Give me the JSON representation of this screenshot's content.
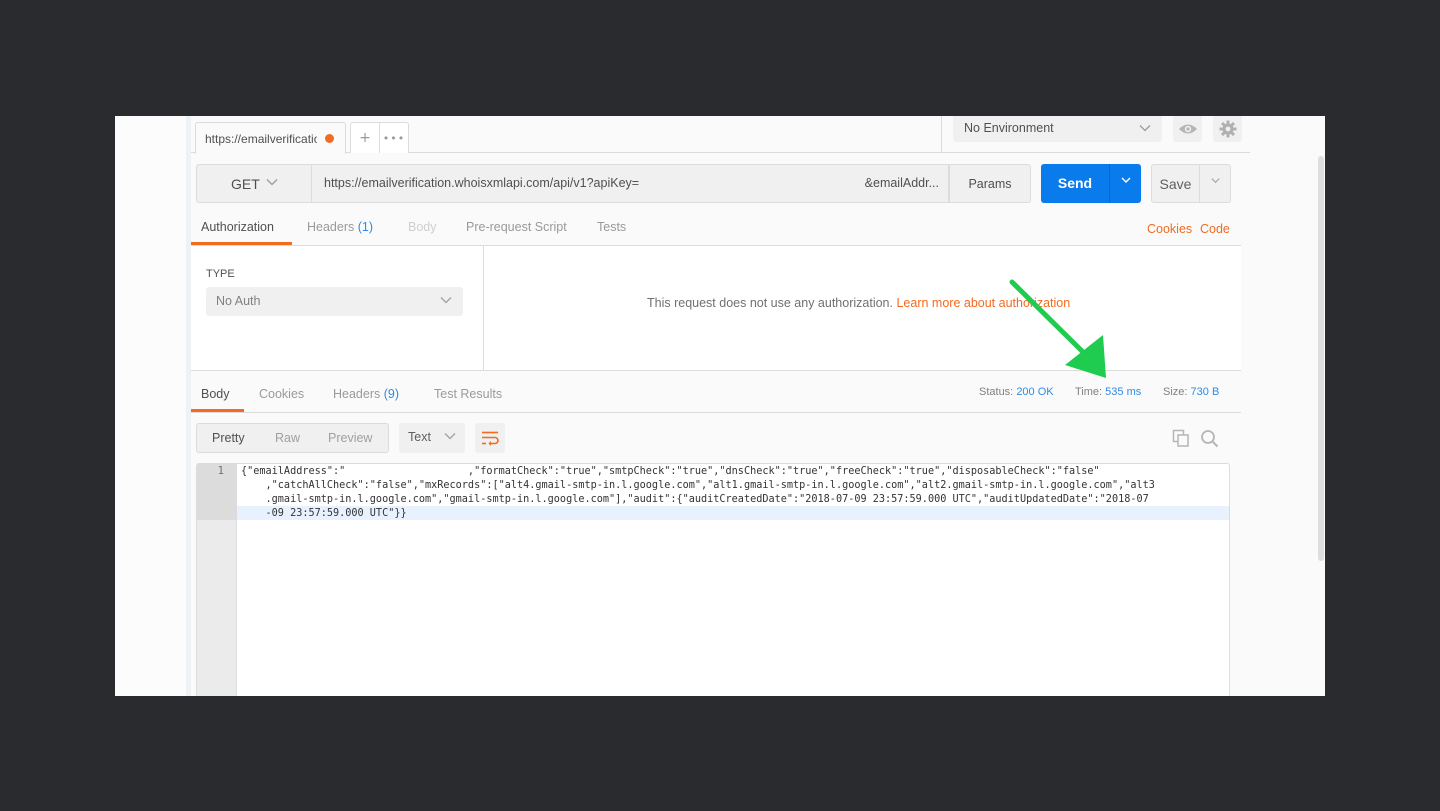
{
  "request_tab": {
    "title": "https://emailverification.whoisxmlapi.com/api/v1?apiKey=",
    "unsaved_dot_color": "#f26b21",
    "new_tab_icon": "plus-icon",
    "more_icon": "ellipsis-icon"
  },
  "environment": {
    "selected": "No Environment",
    "eye_icon": "eye-icon",
    "settings_icon": "gear-icon"
  },
  "url_bar": {
    "method": "GET",
    "url": "https://emailverification.whoisxmlapi.com/api/v1?apiKey=",
    "url_tail": "&emailAddr...",
    "params_label": "Params",
    "send_label": "Send",
    "save_label": "Save"
  },
  "request_tabs": {
    "items": [
      {
        "label": "Authorization",
        "count": null,
        "state": "active"
      },
      {
        "label": "Headers",
        "count": "(1)",
        "state": "inactive"
      },
      {
        "label": "Body",
        "count": null,
        "state": "disabled"
      },
      {
        "label": "Pre-request Script",
        "count": null,
        "state": "inactive"
      },
      {
        "label": "Tests",
        "count": null,
        "state": "inactive"
      }
    ],
    "right_links": [
      "Cookies",
      "Code"
    ]
  },
  "authorization": {
    "type_label": "TYPE",
    "type_value": "No Auth",
    "message": "This request does not use any authorization.",
    "learn_more": "Learn more about authorization"
  },
  "response_tabs": {
    "items": [
      {
        "label": "Body",
        "count": null,
        "state": "active"
      },
      {
        "label": "Cookies",
        "count": null,
        "state": "inactive"
      },
      {
        "label": "Headers",
        "count": "(9)",
        "state": "inactive"
      },
      {
        "label": "Test Results",
        "count": null,
        "state": "inactive"
      }
    ]
  },
  "response_meta": {
    "status_label": "Status:",
    "status_value": "200 OK",
    "time_label": "Time:",
    "time_value": "535 ms",
    "size_label": "Size:",
    "size_value": "730 B"
  },
  "response_toolbar": {
    "views": [
      "Pretty",
      "Raw",
      "Preview"
    ],
    "active_view": "Pretty",
    "format": "Text",
    "wrap_icon": "wrap-lines-icon",
    "copy_icon": "copy-icon",
    "search_icon": "search-icon"
  },
  "response_body": {
    "line_number": "1",
    "lines": [
      "{\"emailAddress\":\"                    ,\"formatCheck\":\"true\",\"smtpCheck\":\"true\",\"dnsCheck\":\"true\",\"freeCheck\":\"true\",\"disposableCheck\":\"false\"",
      "    ,\"catchAllCheck\":\"false\",\"mxRecords\":[\"alt4.gmail-smtp-in.l.google.com\",\"alt1.gmail-smtp-in.l.google.com\",\"alt2.gmail-smtp-in.l.google.com\",\"alt3",
      "    .gmail-smtp-in.l.google.com\",\"gmail-smtp-in.l.google.com\"],\"audit\":{\"auditCreatedDate\":\"2018-07-09 23:57:59.000 UTC\",\"auditUpdatedDate\":\"2018-07",
      "    -09 23:57:59.000 UTC\"}}"
    ]
  },
  "annotation": {
    "arrow_color": "#1fcc4f",
    "points_to": "Time: 535 ms"
  },
  "colors": {
    "accent_orange": "#f26b21",
    "send_blue": "#097bed",
    "count_blue": "#2f8be6",
    "backdrop": "#2a2b2f"
  }
}
